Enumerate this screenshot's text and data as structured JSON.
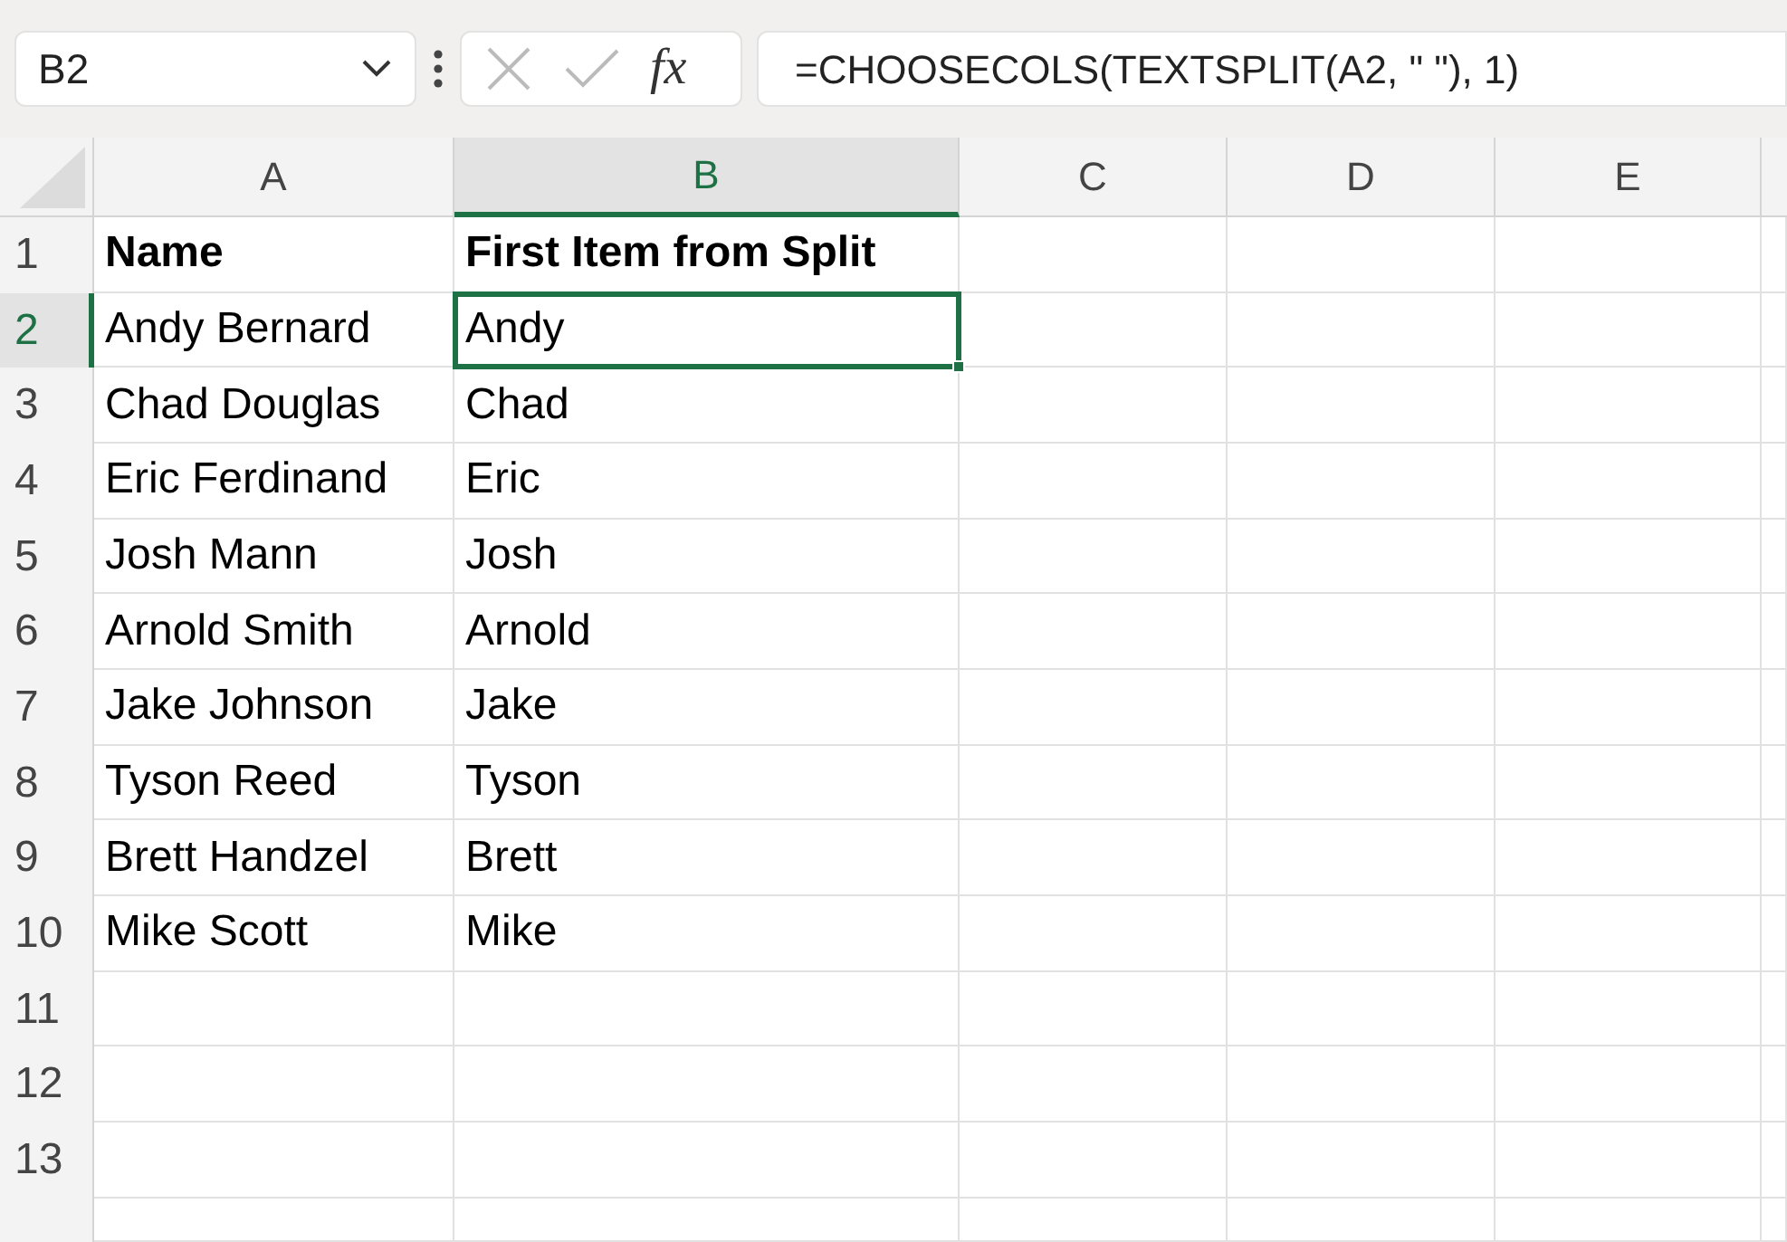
{
  "name_box": {
    "value": "B2"
  },
  "formula_bar": {
    "function_label": "fx",
    "value": "=CHOOSECOLS(TEXTSPLIT(A2, \" \"), 1)"
  },
  "columns": [
    {
      "label": "A",
      "selected": false
    },
    {
      "label": "B",
      "selected": true
    },
    {
      "label": "C",
      "selected": false
    },
    {
      "label": "D",
      "selected": false
    },
    {
      "label": "E",
      "selected": false
    }
  ],
  "rows": [
    {
      "number": "1",
      "selected": false,
      "kind": "header",
      "cells": [
        {
          "text": "Name",
          "selected": false
        },
        {
          "text": "First Item from Split",
          "selected": false
        }
      ]
    },
    {
      "number": "2",
      "selected": true,
      "kind": "data",
      "cells": [
        {
          "text": "Andy Bernard",
          "selected": false
        },
        {
          "text": "Andy",
          "selected": true
        }
      ]
    },
    {
      "number": "3",
      "selected": false,
      "kind": "data",
      "cells": [
        {
          "text": "Chad Douglas",
          "selected": false
        },
        {
          "text": "Chad",
          "selected": false
        }
      ]
    },
    {
      "number": "4",
      "selected": false,
      "kind": "data",
      "cells": [
        {
          "text": "Eric Ferdinand",
          "selected": false
        },
        {
          "text": "Eric",
          "selected": false
        }
      ]
    },
    {
      "number": "5",
      "selected": false,
      "kind": "data",
      "cells": [
        {
          "text": "Josh Mann",
          "selected": false
        },
        {
          "text": "Josh",
          "selected": false
        }
      ]
    },
    {
      "number": "6",
      "selected": false,
      "kind": "data",
      "cells": [
        {
          "text": "Arnold Smith",
          "selected": false
        },
        {
          "text": "Arnold",
          "selected": false
        }
      ]
    },
    {
      "number": "7",
      "selected": false,
      "kind": "data",
      "cells": [
        {
          "text": "Jake Johnson",
          "selected": false
        },
        {
          "text": "Jake",
          "selected": false
        }
      ]
    },
    {
      "number": "8",
      "selected": false,
      "kind": "data",
      "cells": [
        {
          "text": "Tyson Reed",
          "selected": false
        },
        {
          "text": "Tyson",
          "selected": false
        }
      ]
    },
    {
      "number": "9",
      "selected": false,
      "kind": "data",
      "cells": [
        {
          "text": "Brett Handzel",
          "selected": false
        },
        {
          "text": "Brett",
          "selected": false
        }
      ]
    },
    {
      "number": "10",
      "selected": false,
      "kind": "data",
      "cells": [
        {
          "text": "Mike Scott",
          "selected": false
        },
        {
          "text": "Mike",
          "selected": false
        }
      ]
    },
    {
      "number": "11",
      "selected": false,
      "kind": "data",
      "cells": []
    },
    {
      "number": "12",
      "selected": false,
      "kind": "data",
      "cells": []
    },
    {
      "number": "13",
      "selected": false,
      "kind": "data",
      "cells": []
    }
  ]
}
